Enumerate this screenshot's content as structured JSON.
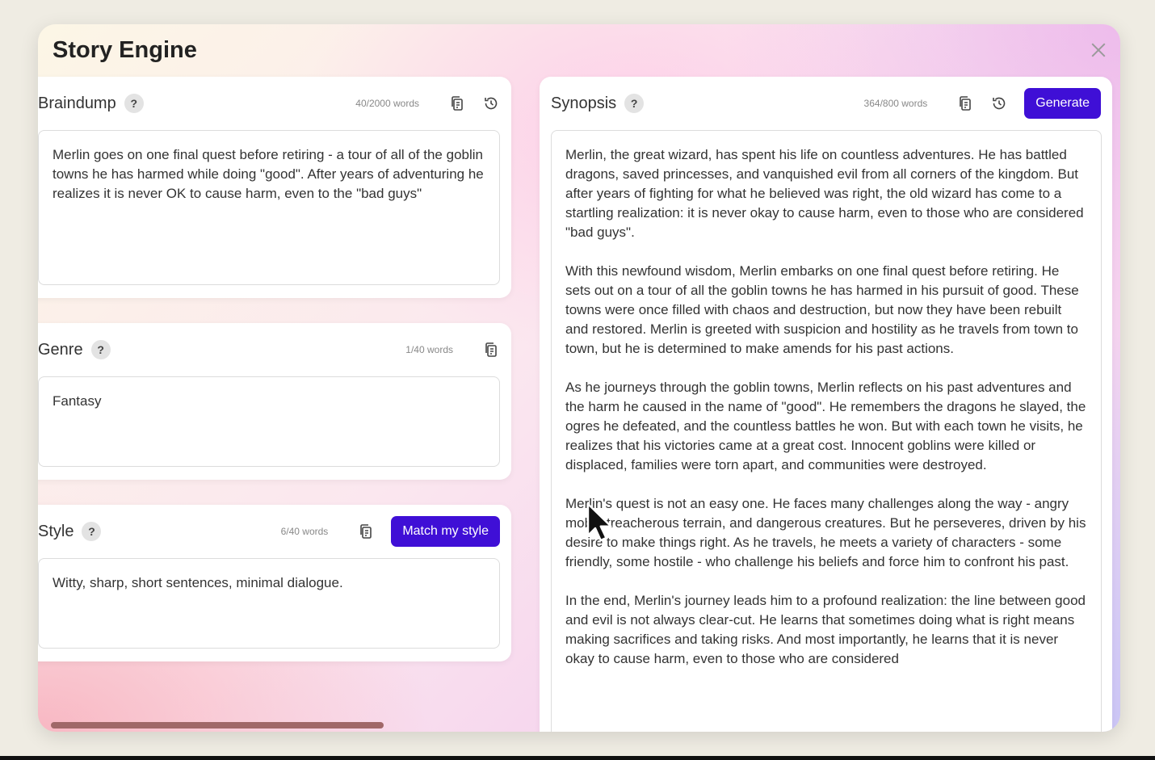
{
  "app": {
    "title": "Story Engine",
    "close_icon": "close-icon"
  },
  "braindump": {
    "title": "Braindump",
    "help": "?",
    "word_count": "40/2000 words",
    "text": "Merlin goes on one final quest before retiring - a tour of all of the goblin towns he has harmed while doing \"good\". After years of adventuring he realizes it is never OK to cause harm, even to the \"bad guys\""
  },
  "genre": {
    "title": "Genre",
    "help": "?",
    "word_count": "1/40 words",
    "text": "Fantasy"
  },
  "style": {
    "title": "Style",
    "help": "?",
    "word_count": "6/40 words",
    "button_label": "Match my style",
    "text": "Witty, sharp, short sentences, minimal dialogue."
  },
  "synopsis": {
    "title": "Synopsis",
    "help": "?",
    "word_count": "364/800 words",
    "button_label": "Generate",
    "paragraphs": [
      "Merlin, the great wizard, has spent his life on countless adventures. He has battled dragons, saved princesses, and vanquished evil from all corners of the kingdom. But after years of fighting for what he believed was right, the old wizard has come to a startling realization: it is never okay to cause harm, even to those who are considered \"bad guys\".",
      "With this newfound wisdom, Merlin embarks on one final quest before retiring. He sets out on a tour of all the goblin towns he has harmed in his pursuit of good. These towns were once filled with chaos and destruction, but now they have been rebuilt and restored. Merlin is greeted with suspicion and hostility as he travels from town to town, but he is determined to make amends for his past actions.",
      "As he journeys through the goblin towns, Merlin reflects on his past adventures and the harm he caused in the name of \"good\". He remembers the dragons he slayed, the ogres he defeated, and the countless battles he won. But with each town he visits, he realizes that his victories came at a great cost. Innocent goblins were killed or displaced, families were torn apart, and communities were destroyed.",
      "Merlin's quest is not an easy one. He faces many challenges along the way - angry mobs, treacherous terrain, and dangerous creatures. But he perseveres, driven by his desire to make things right. As he travels, he meets a variety of characters - some friendly, some hostile - who challenge his beliefs and force him to confront his past.",
      "In the end, Merlin's journey leads him to a profound realization: the line between good and evil is not always clear-cut. He learns that sometimes doing what is right means making sacrifices and taking risks. And most importantly, he learns that it is never okay to cause harm, even to those who are considered"
    ]
  },
  "colors": {
    "accent": "#3f0fd6",
    "scrollbar": "#a06868"
  }
}
